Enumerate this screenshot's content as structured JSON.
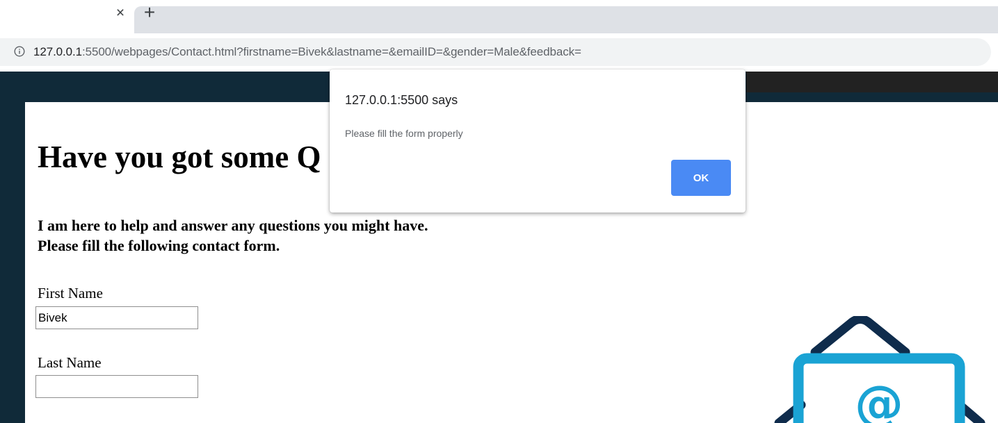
{
  "browser": {
    "tab": {
      "close_glyph": "×",
      "new_tab_glyph": "+"
    },
    "address_bar": {
      "url_host": "127.0.0.1",
      "url_rest": ":5500/webpages/Contact.html?firstname=Bivek&lastname=&emailID=&gender=Male&feedback=",
      "security_icon": "info-circle-icon"
    }
  },
  "page": {
    "heading": "Have you got some Q",
    "intro_line1": "I am here to help and answer any questions you might have.",
    "intro_line2": "Please fill the following contact form.",
    "form": {
      "first_name_label": "First Name",
      "first_name_value": "Bivek",
      "last_name_label": "Last Name",
      "last_name_value": ""
    },
    "illustration_icon": "email-envelope-icon"
  },
  "dialog": {
    "title": "127.0.0.1:5500 says",
    "message": "Please fill the form properly",
    "ok_label": "OK"
  },
  "colors": {
    "page_background": "#102a39",
    "dialog_button": "#4a8af4",
    "envelope_dark": "#0f2c4c",
    "envelope_light": "#1aa3d4"
  }
}
